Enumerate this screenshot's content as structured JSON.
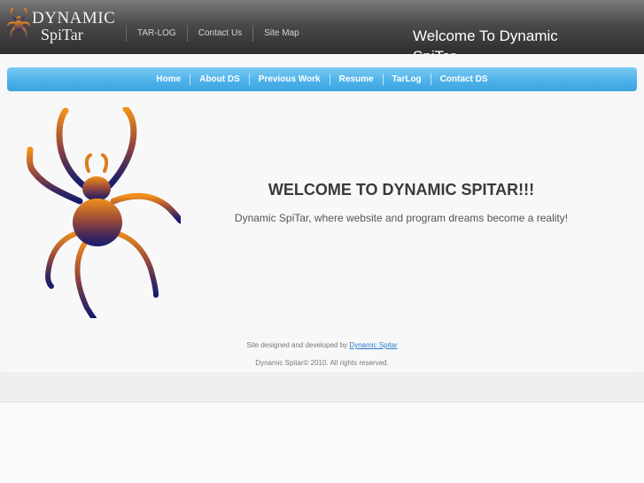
{
  "header": {
    "logo": {
      "line1": "DYNAMIC",
      "line2": "SpiTar",
      "icon": "spider-icon"
    },
    "links": [
      {
        "label": "TAR-LOG"
      },
      {
        "label": "Contact Us"
      },
      {
        "label": "Site Map"
      }
    ],
    "welcome": "Welcome To Dynamic SpiTar"
  },
  "nav": {
    "items": [
      {
        "label": "Home"
      },
      {
        "label": "About DS"
      },
      {
        "label": "Previous Work"
      },
      {
        "label": "Resume"
      },
      {
        "label": "TarLog"
      },
      {
        "label": "Contact DS"
      }
    ]
  },
  "main": {
    "image_icon": "spider-illustration",
    "title": "WELCOME TO DYNAMIC SPITAR!!!",
    "subtitle": "Dynamic SpiTar, where website and program dreams become a reality!"
  },
  "footer": {
    "designed_prefix": "Site designed and developed by",
    "designed_link": "Dynamic Spitar",
    "copyright": "Dynamic Spitar© 2010. All rights reserved."
  },
  "colors": {
    "header_bg": "#3a3a3a",
    "nav_bg": "#4eb2ea",
    "spider_orange": "#f08a1c",
    "spider_navy": "#1a1f6a",
    "link": "#2a7ad0"
  }
}
